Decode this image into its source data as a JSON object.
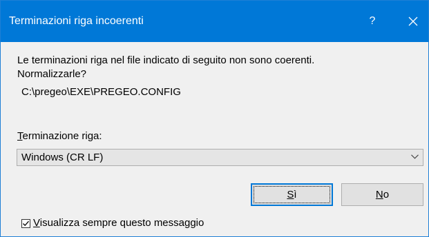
{
  "dialog": {
    "title": "Terminazioni riga incoerenti",
    "help_glyph": "?",
    "message_line1": "Le terminazioni riga nel file indicato di seguito non sono coerenti.",
    "message_line2": "Normalizzarle?",
    "file_path": "C:\\pregeo\\EXE\\PREGEO.CONFIG",
    "combo_label_accel": "T",
    "combo_label_rest": "erminazione riga:",
    "combo_value": "Windows (CR LF)",
    "yes_accel": "S",
    "yes_rest": "ì",
    "no_accel": "N",
    "no_rest": "o",
    "checkbox_checked": true,
    "checkbox_accel": "V",
    "checkbox_rest": "isualizza sempre questo messaggio"
  },
  "colors": {
    "titlebar": "#0078d7",
    "background": "#f0f0f0"
  }
}
